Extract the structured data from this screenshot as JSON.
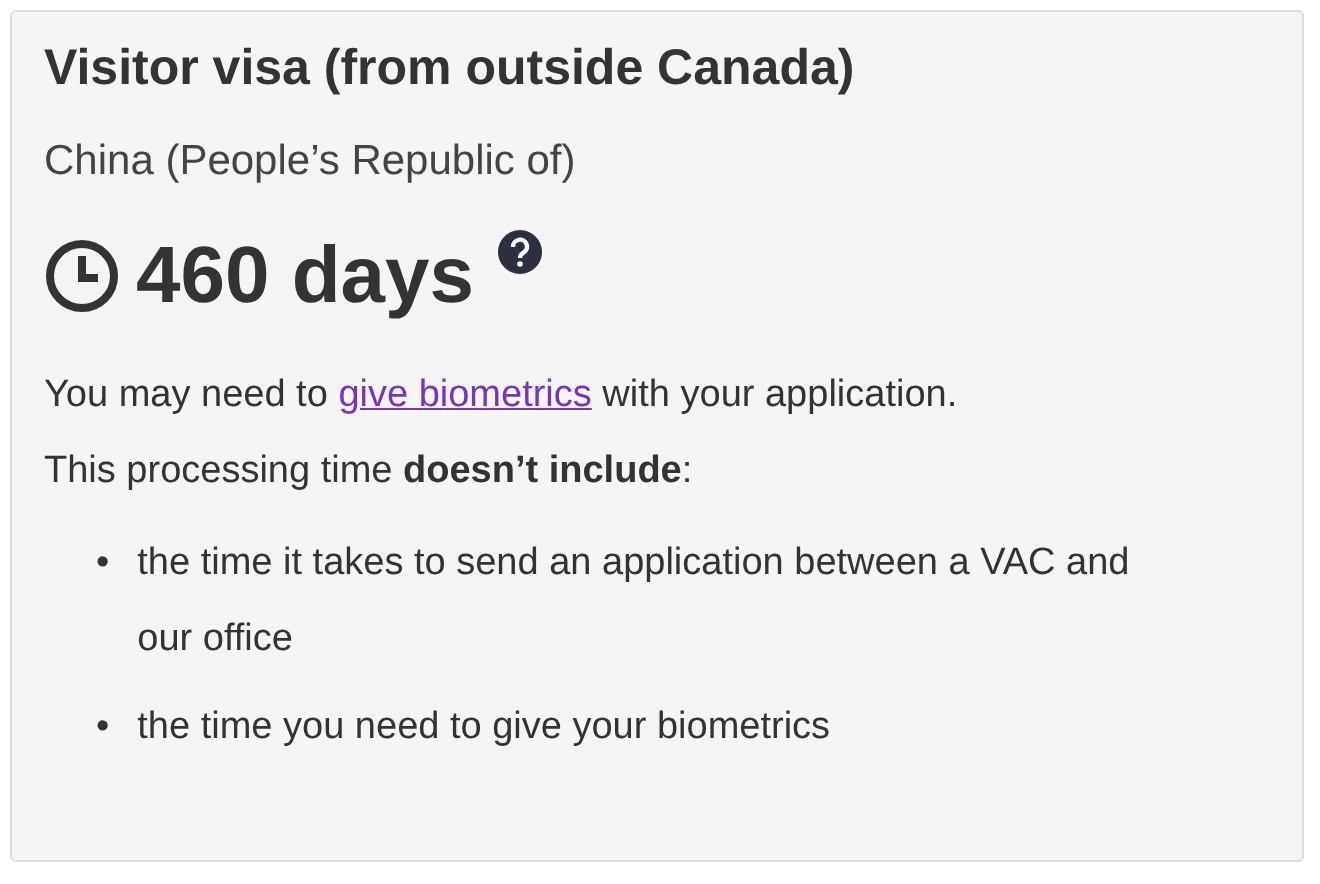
{
  "card": {
    "title": "Visitor visa (from outside Canada)",
    "country": "China (People’s Republic of)",
    "processing_time": "460 days",
    "biometrics_note": {
      "before": "You may need to ",
      "link": "give biometrics",
      "after": " with your application."
    },
    "exclusions_intro": "This processing time **doesn’t include**:",
    "exclusions": [
      {
        "marker": "•",
        "text": "the time it takes to send an application between a VAC and our office"
      },
      {
        "marker": "•",
        "text": "the time you need to give your biometrics"
      }
    ]
  }
}
